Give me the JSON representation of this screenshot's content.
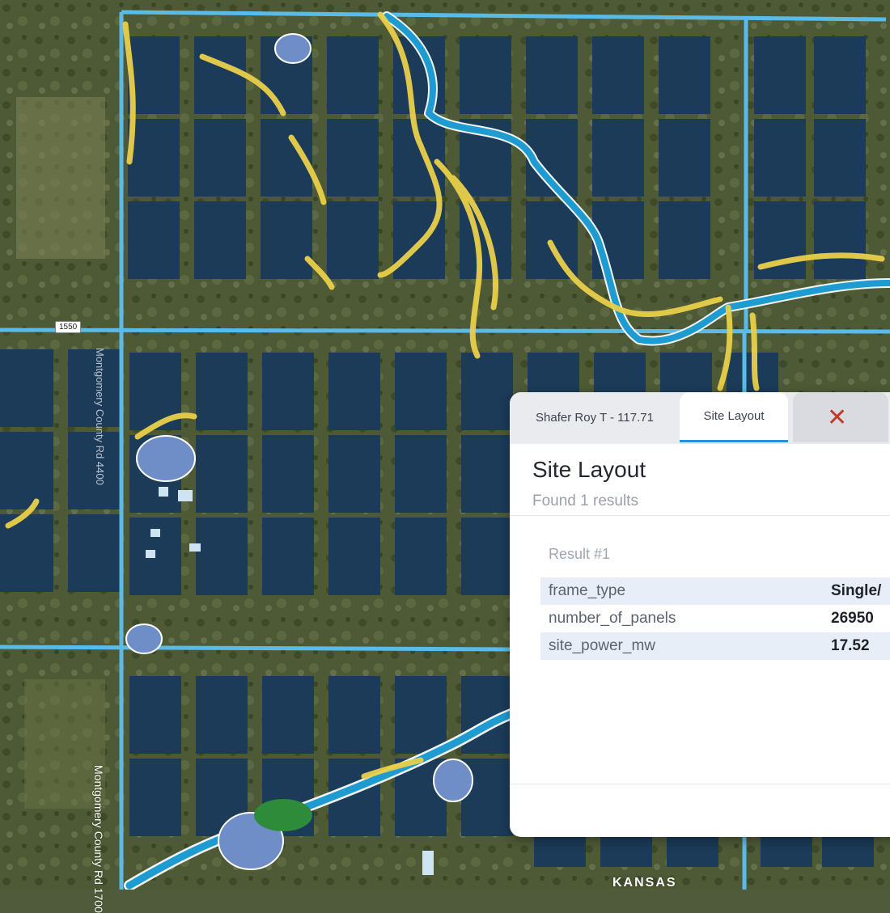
{
  "map": {
    "road_shield": "1550",
    "road_name": "Montgomery County Rd 1700",
    "road_name_2": "Montgomery County Rd 4400",
    "place_label": "KANSAS",
    "colors": {
      "panel_fill": "#1b3b58",
      "boundary": "#5bbbe8",
      "stream": "#1e9bd0",
      "wetland": "#e9cf4a",
      "pond": "#6f8ec7",
      "vegetation": "#2e8b3a"
    }
  },
  "panel": {
    "tabs": [
      {
        "label": "Shafer Roy T - 117.71"
      },
      {
        "label": "Site Layout"
      },
      {
        "icon": "close-icon",
        "glyph": "✕"
      }
    ],
    "title": "Site Layout",
    "subtitle": "Found 1 results",
    "result_heading": "Result #1",
    "rows": [
      {
        "key": "frame_type",
        "value": "Single/"
      },
      {
        "key": "number_of_panels",
        "value": "26950"
      },
      {
        "key": "site_power_mw",
        "value": "17.52"
      }
    ]
  }
}
